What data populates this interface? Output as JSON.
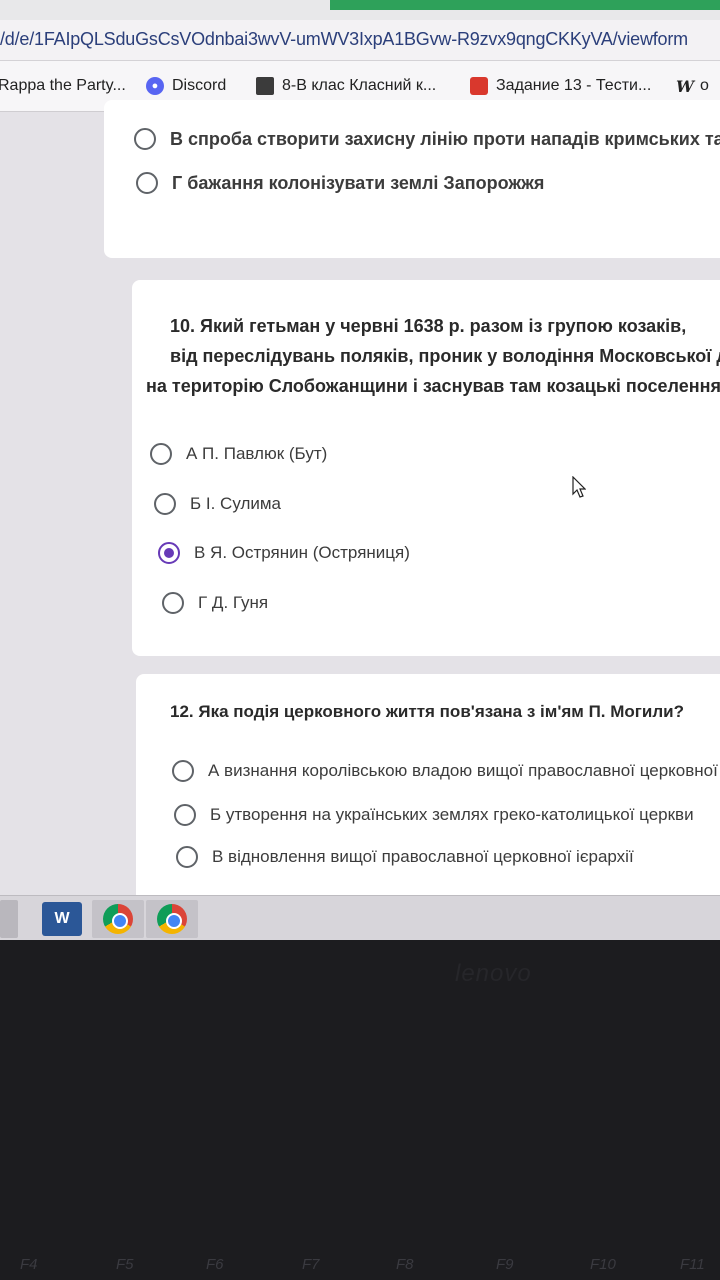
{
  "browser": {
    "url": "/d/e/1FAIpQLSduGsCsVOdnbai3wvV-umWV3IxpA1BGvw-R9zvx9qngCKKyVA/viewform",
    "bookmarks": [
      {
        "label": "Rappa the Party...",
        "icon": "none"
      },
      {
        "label": "Discord",
        "icon": "discord-icon"
      },
      {
        "label": "8-В клас Класний к...",
        "icon": "classroom-icon"
      },
      {
        "label": "Задание 13 - Тести...",
        "icon": "quiz-icon"
      },
      {
        "label": "о",
        "icon": "wikipedia-icon"
      }
    ]
  },
  "question9": {
    "options": [
      {
        "label": "В спроба створити захисну лінію проти нападів кримських татар",
        "selected": false
      },
      {
        "label": "Г бажання колонізувати землі Запорожжя",
        "selected": false
      }
    ]
  },
  "question10": {
    "lines": [
      "10. Який гетьман у червні 1638 р. разом із групою козаків,",
      "від переслідувань поляків, проник у володіння Московської держави",
      "на територію Слобожанщини і заснував там козацькі поселення?"
    ],
    "options": [
      {
        "label": "А П. Павлюк (Бут)",
        "selected": false
      },
      {
        "label": "Б І. Сулима",
        "selected": false
      },
      {
        "label": "В Я. Острянин (Остряниця)",
        "selected": true
      },
      {
        "label": "Г Д. Гуня",
        "selected": false
      }
    ]
  },
  "question12": {
    "title": "12. Яка подія церковного життя пов'язана з ім'ям П. Могили?",
    "options": [
      {
        "label": "А визнання королівською владою вищої православної церковної ієрархії",
        "selected": false
      },
      {
        "label": "Б утворення на українських землях греко-католицької церкви",
        "selected": false
      },
      {
        "label": "В відновлення вищої православної церковної ієрархії",
        "selected": false
      }
    ]
  },
  "taskbar": {
    "word_label": "W"
  },
  "laptop": {
    "brand": "lenovo",
    "fkeys": [
      "F4",
      "F5",
      "F6",
      "F7",
      "F8",
      "F9",
      "F10",
      "F11"
    ]
  },
  "colors": {
    "accent": "#673ab7",
    "background": "#e4e2e7"
  }
}
